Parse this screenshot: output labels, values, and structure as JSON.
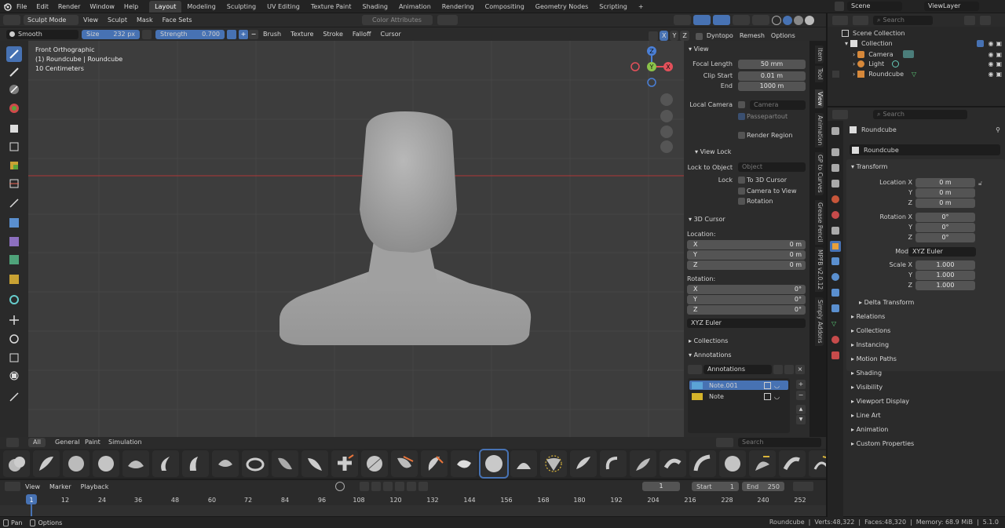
{
  "topbar": {
    "menus": [
      "File",
      "Edit",
      "Render",
      "Window",
      "Help"
    ],
    "workspaces": [
      "Layout",
      "Modeling",
      "Sculpting",
      "UV Editing",
      "Texture Paint",
      "Shading",
      "Animation",
      "Rendering",
      "Compositing",
      "Geometry Nodes",
      "Scripting"
    ],
    "active_workspace": "Layout",
    "add_tab": "+",
    "scene": "Scene",
    "view_layer": "ViewLayer"
  },
  "viewport_header": {
    "mode": "Sculpt Mode",
    "menus": [
      "View",
      "Sculpt",
      "Mask",
      "Face Sets"
    ],
    "color_attributes": "Color Attributes"
  },
  "tool_header": {
    "brush_name": "Smooth",
    "size_label": "Size",
    "size_value": "232 px",
    "strength_label": "Strength",
    "strength_value": "0.700",
    "dropdowns": [
      "Brush",
      "Texture",
      "Stroke",
      "Falloff",
      "Cursor"
    ],
    "axes": [
      "X",
      "Y",
      "Z"
    ],
    "dyntopo": "Dyntopo",
    "remesh": "Remesh",
    "options": "Options"
  },
  "viewport": {
    "title": "Front Orthographic",
    "object": "(1) Roundcube | Roundcube",
    "scale": "10 Centimeters",
    "gizmo": {
      "x": "X",
      "y": "Y",
      "z": "Z"
    }
  },
  "n_panel": {
    "view_header": "View",
    "focal_length_label": "Focal Length",
    "focal_length": "50 mm",
    "clip_start_label": "Clip Start",
    "clip_start": "0.01 m",
    "end_label": "End",
    "clip_end": "1000 m",
    "local_camera_label": "Local Camera",
    "camera_placeholder": "Camera",
    "passepartout": "Passepartout",
    "render_region": "Render Region",
    "view_lock_header": "View Lock",
    "lock_to_object_label": "Lock to Object",
    "object_placeholder": "Object",
    "lock_label": "Lock",
    "to_3d_cursor": "To 3D Cursor",
    "camera_to_view": "Camera to View",
    "rotation_lock": "Rotation",
    "cursor_header": "3D Cursor",
    "location_label": "Location:",
    "loc": [
      {
        "axis": "X",
        "value": "0 m"
      },
      {
        "axis": "Y",
        "value": "0 m"
      },
      {
        "axis": "Z",
        "value": "0 m"
      }
    ],
    "rotation_label": "Rotation:",
    "rot": [
      {
        "axis": "X",
        "value": "0°"
      },
      {
        "axis": "Y",
        "value": "0°"
      },
      {
        "axis": "Z",
        "value": "0°"
      }
    ],
    "rotation_mode": "XYZ Euler",
    "collections_header": "Collections",
    "annotations_header": "Annotations",
    "annotations_name": "Annotations",
    "notes": [
      {
        "name": "Note.001",
        "color": "#5ba3d6"
      },
      {
        "name": "Note",
        "color": "#d6b42a"
      }
    ],
    "vtabs": [
      "Item",
      "Tool",
      "View",
      "Animation",
      "GP to Curves",
      "Grease Pencil",
      "MPFB v2.0.12",
      "Simply Addons"
    ]
  },
  "brush_shelf": {
    "tabs": [
      "All",
      "General",
      "Paint",
      "Simulation"
    ],
    "active": "All",
    "search_placeholder": "Search"
  },
  "timeline": {
    "menus": [
      "View",
      "Marker",
      "Playback"
    ],
    "current_frame": "1",
    "start_label": "Start",
    "start": "1",
    "end_label": "End",
    "end": "250",
    "ticks": [
      "1",
      "12",
      "24",
      "36",
      "48",
      "60",
      "72",
      "84",
      "96",
      "108",
      "120",
      "132",
      "144",
      "156",
      "168",
      "180",
      "192",
      "204",
      "216",
      "228",
      "240",
      "252"
    ]
  },
  "statusbar": {
    "left": [
      "Pan",
      "Options"
    ],
    "object": "Roundcube",
    "verts": "Verts:48,322",
    "faces": "Faces:48,320",
    "memory": "Memory: 68.9 MiB",
    "version": "5.1.0"
  },
  "outliner": {
    "search_placeholder": "Search",
    "root": "Scene Collection",
    "collection": "Collection",
    "items": [
      "Camera",
      "Light",
      "Roundcube"
    ]
  },
  "properties": {
    "search_placeholder": "Search",
    "object_name": "Roundcube",
    "data_name": "Roundcube",
    "transform_header": "Transform",
    "location_labels": [
      "Location X",
      "Y",
      "Z"
    ],
    "location_values": [
      "0 m",
      "0 m",
      "0 m"
    ],
    "rotation_labels": [
      "Rotation X",
      "Y",
      "Z"
    ],
    "rotation_values": [
      "0°",
      "0°",
      "0°"
    ],
    "mode_label": "Mode",
    "mode_value": "XYZ Euler",
    "scale_labels": [
      "Scale X",
      "Y",
      "Z"
    ],
    "scale_values": [
      "1.000",
      "1.000",
      "1.000"
    ],
    "delta_transform": "Delta Transform",
    "sections": [
      "Relations",
      "Collections",
      "Instancing",
      "Motion Paths",
      "Shading",
      "Visibility",
      "Viewport Display",
      "Line Art",
      "Animation",
      "Custom Properties"
    ]
  },
  "colors": {
    "accent": "#4772b3",
    "background": "#1d1d1d",
    "viewport": "#3d3d3d",
    "panel": "#2c2c2c",
    "x_axis": "#e3505a",
    "y_axis": "#8bc34a",
    "z_axis": "#4a7fd6"
  }
}
